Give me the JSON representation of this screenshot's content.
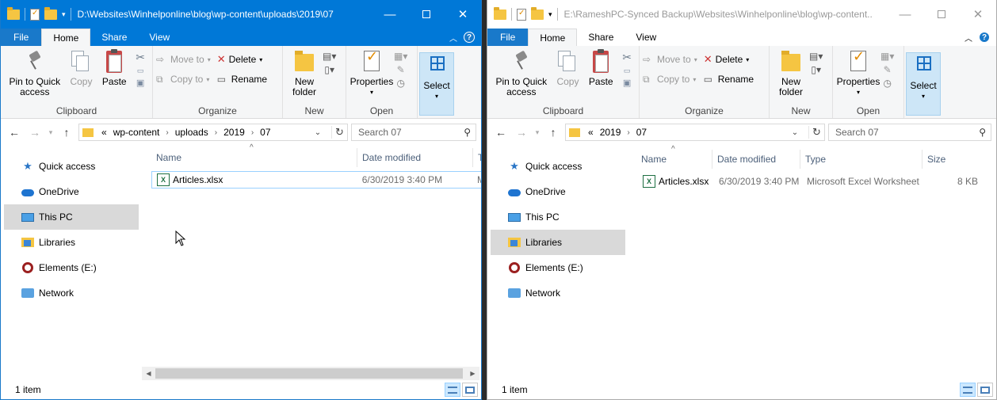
{
  "left": {
    "title": "D:\\Websites\\Winhelponline\\blog\\wp-content\\uploads\\2019\\07",
    "tabs": {
      "file": "File",
      "home": "Home",
      "share": "Share",
      "view": "View"
    },
    "ribbon": {
      "pin": "Pin to Quick access",
      "copy": "Copy",
      "paste": "Paste",
      "clipboard": "Clipboard",
      "move_to": "Move to",
      "copy_to": "Copy to",
      "delete": "Delete",
      "rename": "Rename",
      "organize": "Organize",
      "new_folder": "New folder",
      "new": "New",
      "properties": "Properties",
      "open": "Open",
      "select": "Select"
    },
    "breadcrumb": [
      "«",
      "wp-content",
      "uploads",
      "2019",
      "07"
    ],
    "search_placeholder": "Search 07",
    "nav": [
      "Quick access",
      "OneDrive",
      "This PC",
      "Libraries",
      "Elements (E:)",
      "Network"
    ],
    "selected_nav": "This PC",
    "columns": {
      "name": "Name",
      "date": "Date modified",
      "type": "T"
    },
    "rows": [
      {
        "name": "Articles.xlsx",
        "date": "6/30/2019 3:40 PM",
        "type": "M"
      }
    ],
    "status": "1 item"
  },
  "right": {
    "title": "E:\\RameshPC-Synced Backup\\Websites\\Winhelponline\\blog\\wp-content...",
    "tabs": {
      "file": "File",
      "home": "Home",
      "share": "Share",
      "view": "View"
    },
    "ribbon": {
      "pin": "Pin to Quick access",
      "copy": "Copy",
      "paste": "Paste",
      "clipboard": "Clipboard",
      "move_to": "Move to",
      "copy_to": "Copy to",
      "delete": "Delete",
      "rename": "Rename",
      "organize": "Organize",
      "new_folder": "New folder",
      "new": "New",
      "properties": "Properties",
      "open": "Open",
      "select": "Select"
    },
    "breadcrumb": [
      "«",
      "2019",
      "07"
    ],
    "search_placeholder": "Search 07",
    "nav": [
      "Quick access",
      "OneDrive",
      "This PC",
      "Libraries",
      "Elements (E:)",
      "Network"
    ],
    "selected_nav": "Libraries",
    "columns": {
      "name": "Name",
      "date": "Date modified",
      "type": "Type",
      "size": "Size"
    },
    "rows": [
      {
        "name": "Articles.xlsx",
        "date": "6/30/2019 3:40 PM",
        "type": "Microsoft Excel Worksheet",
        "size": "8 KB"
      }
    ],
    "status": "1 item"
  },
  "icons": {
    "minimize": "minimize-icon",
    "maximize": "maximize-icon",
    "close": "close-icon",
    "back": "back-arrow-icon",
    "forward": "forward-arrow-icon",
    "up": "up-arrow-icon",
    "refresh": "refresh-icon",
    "search": "search-icon"
  }
}
